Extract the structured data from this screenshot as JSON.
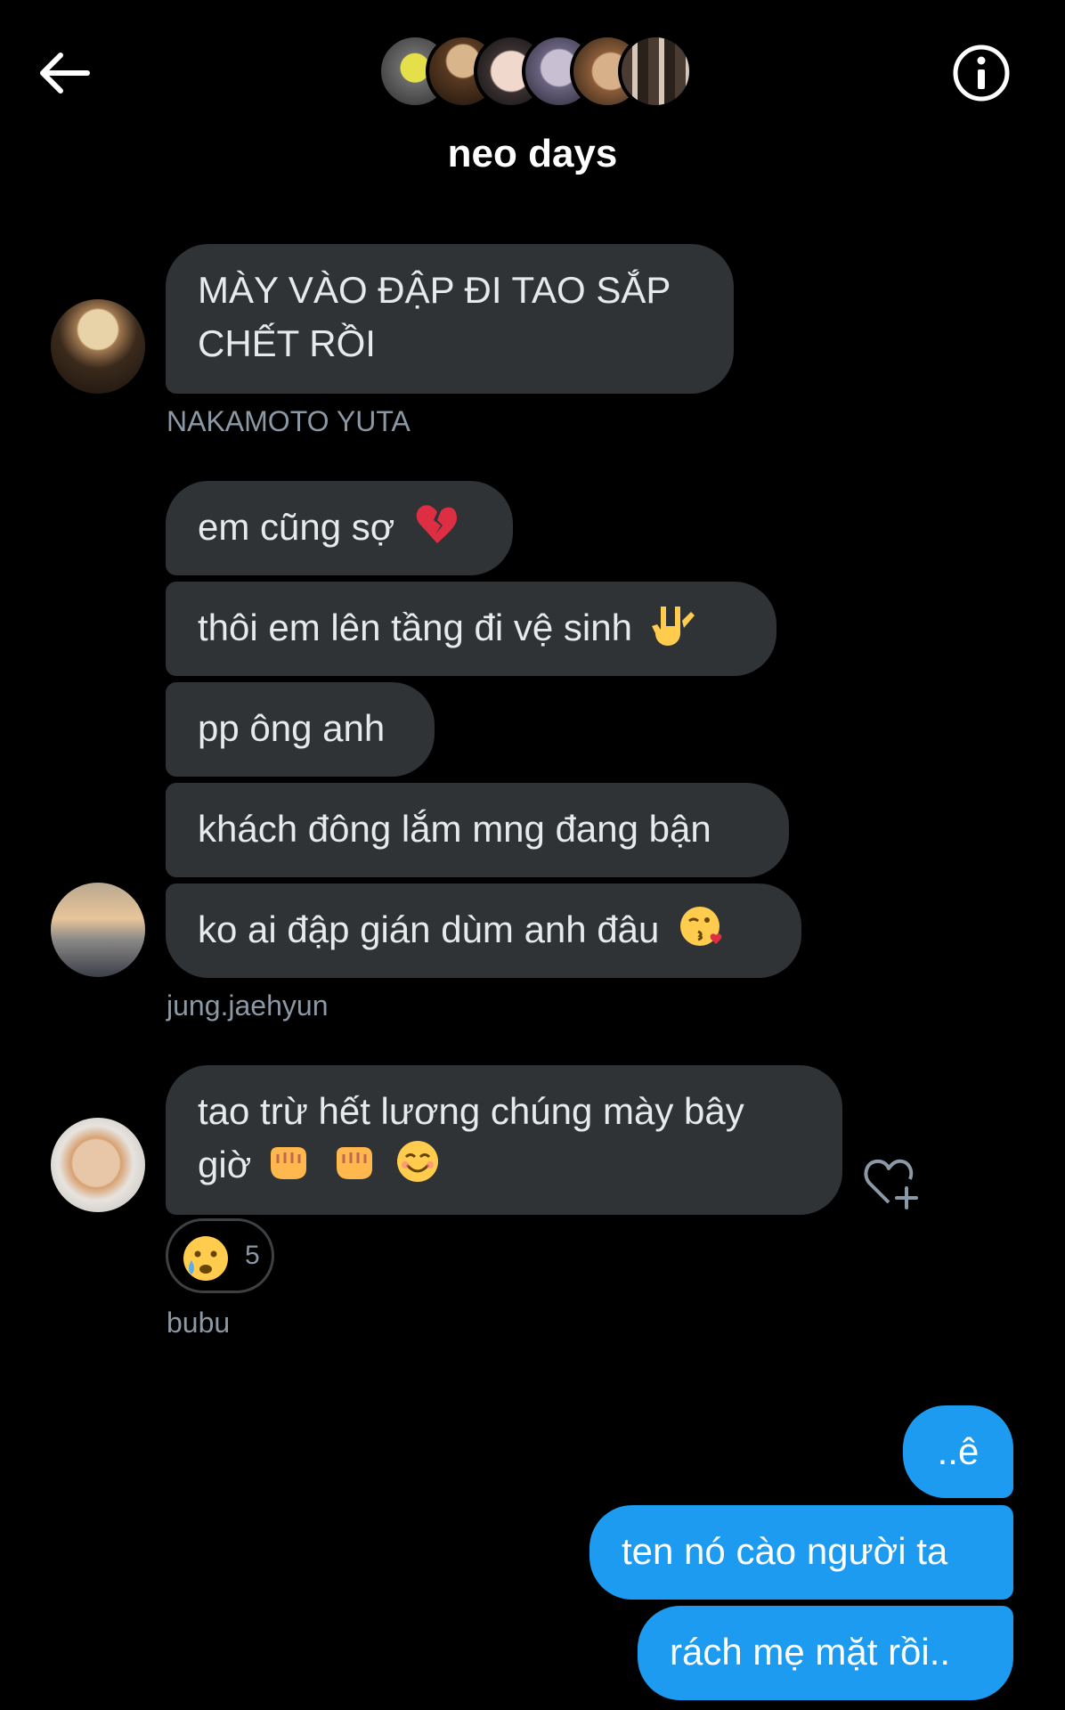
{
  "header": {
    "title": "neo days"
  },
  "messages": [
    {
      "lines": [
        "MÀY VÀO ĐẬP ĐI TAO SẮP",
        "CHẾT RỒI"
      ]
    },
    {
      "text": "NAKAMOTO YUTA"
    },
    {
      "text": "em cũng sợ"
    },
    {
      "text": "thôi em lên tầng đi vệ sinh"
    },
    {
      "text": "pp ông anh"
    },
    {
      "text": "khách đông lắm mng đang bận"
    },
    {
      "text": "ko ai đập gián dùm anh đâu"
    },
    {
      "text": "jung.jaehyun"
    },
    {
      "lines": [
        "tao trừ hết lương chúng mày bây",
        "giờ"
      ]
    },
    {
      "text": "bubu"
    },
    {
      "text": "..ê"
    },
    {
      "text": "ten nó cào người ta"
    },
    {
      "text": "rách mẹ mặt rồi.."
    }
  ],
  "reaction": {
    "count": "5",
    "emoji": "crying-face"
  },
  "icons": {
    "back": "back-arrow-icon",
    "info": "info-icon",
    "react": "heart-plus-icon"
  },
  "colors": {
    "background": "#000000",
    "bubble_other": "#2f3336",
    "bubble_me": "#1d9bf0",
    "secondary_text": "#8b98a5"
  }
}
